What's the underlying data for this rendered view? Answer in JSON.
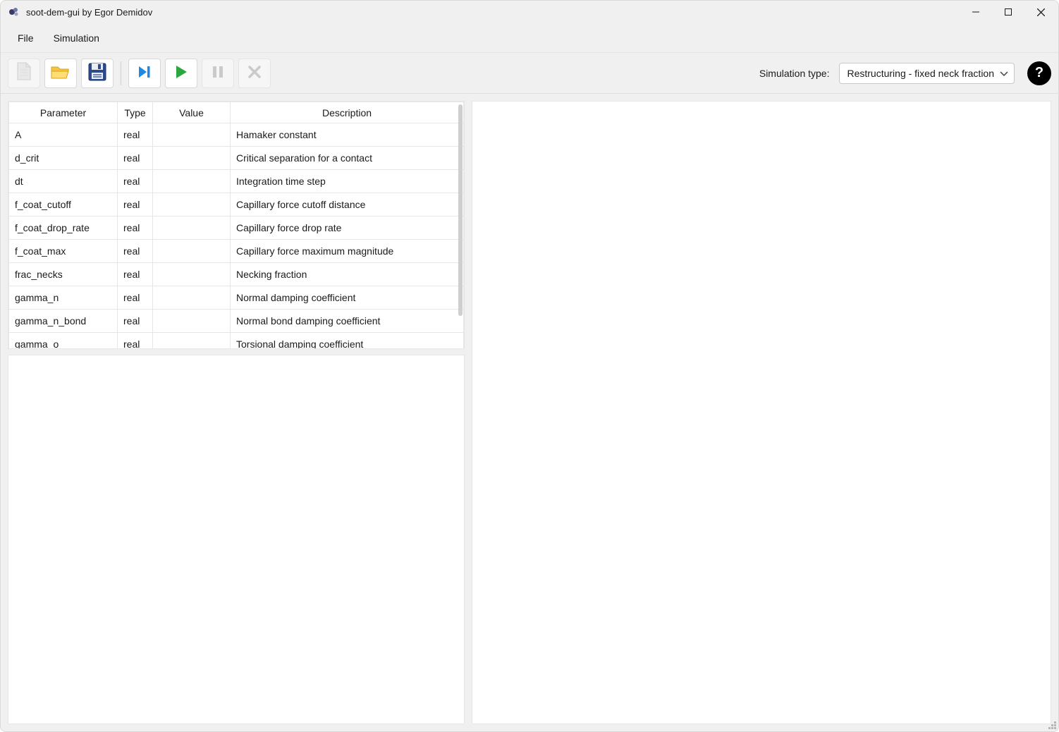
{
  "window": {
    "title": "soot-dem-gui by Egor Demidov"
  },
  "menu": {
    "file": "File",
    "simulation": "Simulation"
  },
  "toolbar": {
    "sim_type_label": "Simulation type:",
    "sim_type_value": "Restructuring - fixed neck fraction",
    "help_label": "?"
  },
  "table": {
    "headers": {
      "parameter": "Parameter",
      "type": "Type",
      "value": "Value",
      "description": "Description"
    },
    "rows": [
      {
        "parameter": "A",
        "type": "real",
        "value": "",
        "description": "Hamaker constant"
      },
      {
        "parameter": "d_crit",
        "type": "real",
        "value": "",
        "description": "Critical separation for a contact"
      },
      {
        "parameter": "dt",
        "type": "real",
        "value": "",
        "description": "Integration time step"
      },
      {
        "parameter": "f_coat_cutoff",
        "type": "real",
        "value": "",
        "description": "Capillary force cutoff distance"
      },
      {
        "parameter": "f_coat_drop_rate",
        "type": "real",
        "value": "",
        "description": "Capillary force drop rate"
      },
      {
        "parameter": "f_coat_max",
        "type": "real",
        "value": "",
        "description": "Capillary force maximum magnitude"
      },
      {
        "parameter": "frac_necks",
        "type": "real",
        "value": "",
        "description": "Necking fraction"
      },
      {
        "parameter": "gamma_n",
        "type": "real",
        "value": "",
        "description": "Normal damping coefficient"
      },
      {
        "parameter": "gamma_n_bond",
        "type": "real",
        "value": "",
        "description": "Normal bond damping coefficient"
      },
      {
        "parameter": "gamma_o",
        "type": "real",
        "value": "",
        "description": "Torsional damping coefficient"
      }
    ]
  }
}
